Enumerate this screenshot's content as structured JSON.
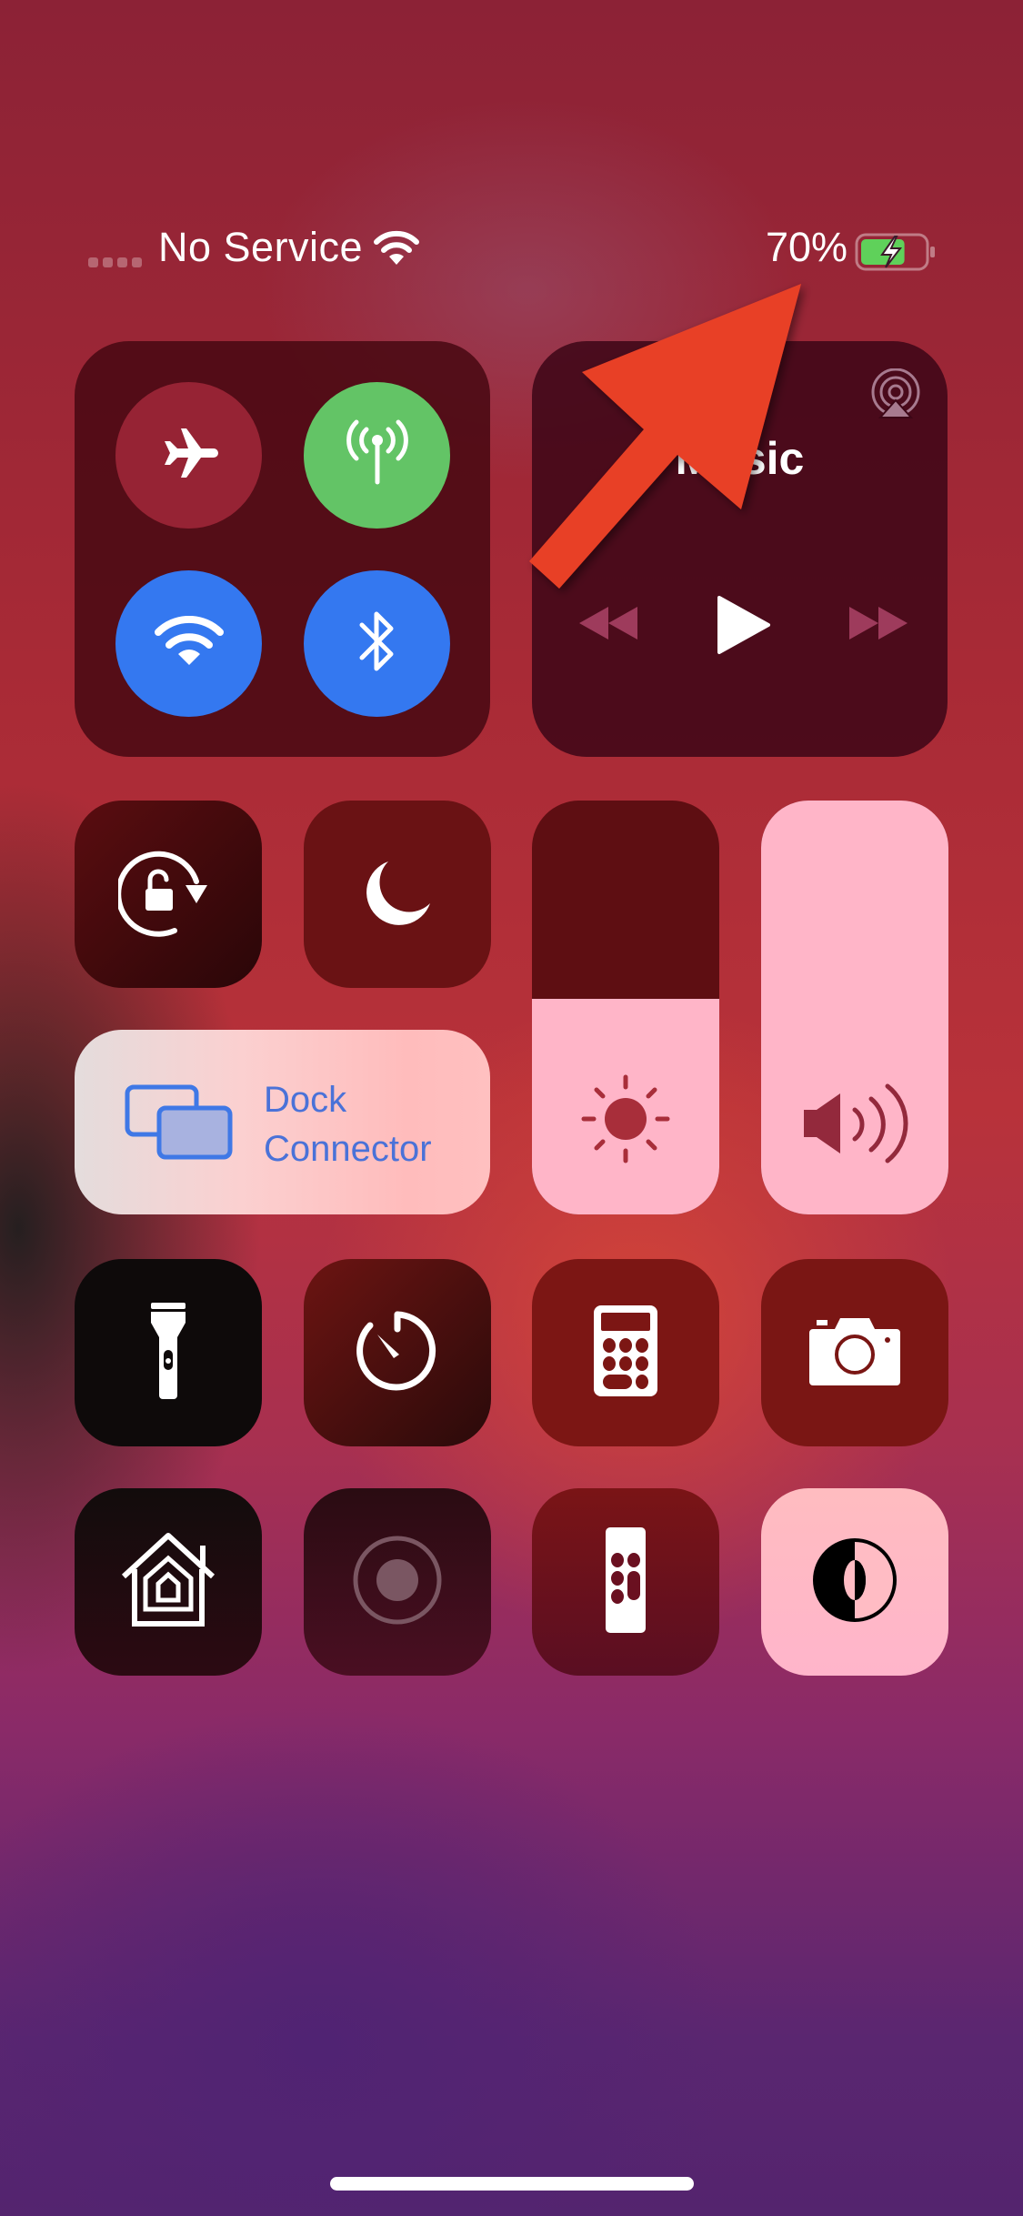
{
  "status_bar": {
    "signal_bars": 4,
    "carrier": "No Service",
    "wifi_icon": "wifi-icon",
    "battery_percent_label": "70%",
    "battery_level": 0.7,
    "battery_charging": true,
    "battery_color": "#5fd15a"
  },
  "connectivity": {
    "airplane_mode": {
      "icon": "airplane-icon",
      "on": false,
      "color": "#962334"
    },
    "cellular_data": {
      "icon": "antenna-icon",
      "on": true,
      "color": "#63c466"
    },
    "wifi": {
      "icon": "wifi-icon",
      "on": true,
      "color": "#3478f0"
    },
    "bluetooth": {
      "icon": "bluetooth-icon",
      "on": true,
      "color": "#3478f0"
    }
  },
  "music": {
    "title": "Music",
    "airplay_icon": "airplay-icon",
    "controls": [
      "rewind",
      "play",
      "fast-forward"
    ]
  },
  "toggles": {
    "orientation_lock": {
      "icon": "rotation-lock-icon"
    },
    "do_not_disturb": {
      "icon": "moon-icon"
    }
  },
  "sliders": {
    "brightness": {
      "icon": "sun-icon",
      "level_percent": 52
    },
    "volume": {
      "icon": "speaker-icon",
      "level_percent": 100
    }
  },
  "screen_mirroring": {
    "label_line1": "Dock",
    "label_line2": "Connector",
    "accent": "#4a72d8"
  },
  "shortcuts": [
    {
      "name": "flashlight",
      "icon": "flashlight-icon"
    },
    {
      "name": "timer",
      "icon": "timer-icon"
    },
    {
      "name": "calculator",
      "icon": "calculator-icon"
    },
    {
      "name": "camera",
      "icon": "camera-icon"
    },
    {
      "name": "home",
      "icon": "home-icon"
    },
    {
      "name": "screen-recording",
      "icon": "record-icon"
    },
    {
      "name": "apple-tv-remote",
      "icon": "remote-icon"
    },
    {
      "name": "dark-mode",
      "icon": "dark-mode-icon"
    }
  ],
  "annotation": {
    "type": "arrow",
    "color": "#e84026",
    "points_to": "battery percentage"
  }
}
